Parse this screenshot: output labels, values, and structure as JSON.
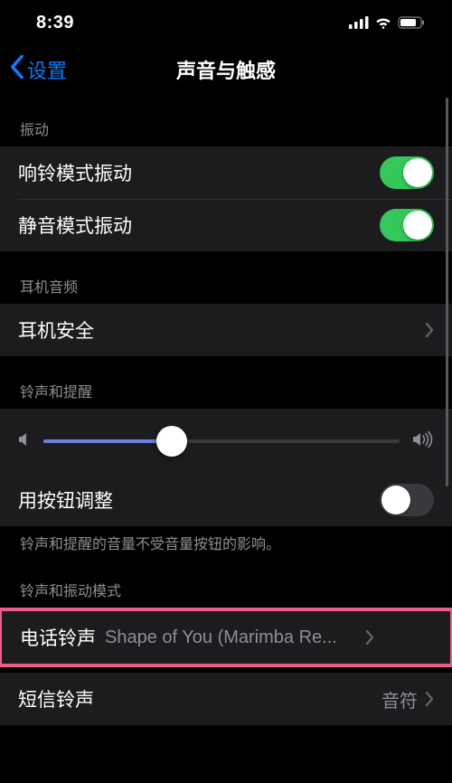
{
  "status": {
    "time": "8:39"
  },
  "nav": {
    "back_label": "设置",
    "title": "声音与触感"
  },
  "sections": {
    "vibration": {
      "header": "振动",
      "ring_label": "响铃模式振动",
      "ring_on": true,
      "silent_label": "静音模式振动",
      "silent_on": true
    },
    "headphone": {
      "header": "耳机音频",
      "safety_label": "耳机安全"
    },
    "ringer": {
      "header": "铃声和提醒",
      "volume_percent": 36,
      "buttons_label": "用按钮调整",
      "buttons_on": false,
      "footer": "铃声和提醒的音量不受音量按钮的影响。"
    },
    "patterns": {
      "header": "铃声和振动模式",
      "ringtone_label": "电话铃声",
      "ringtone_value": "Shape of You (Marimba Re...",
      "text_label": "短信铃声",
      "text_value": "音符"
    }
  }
}
